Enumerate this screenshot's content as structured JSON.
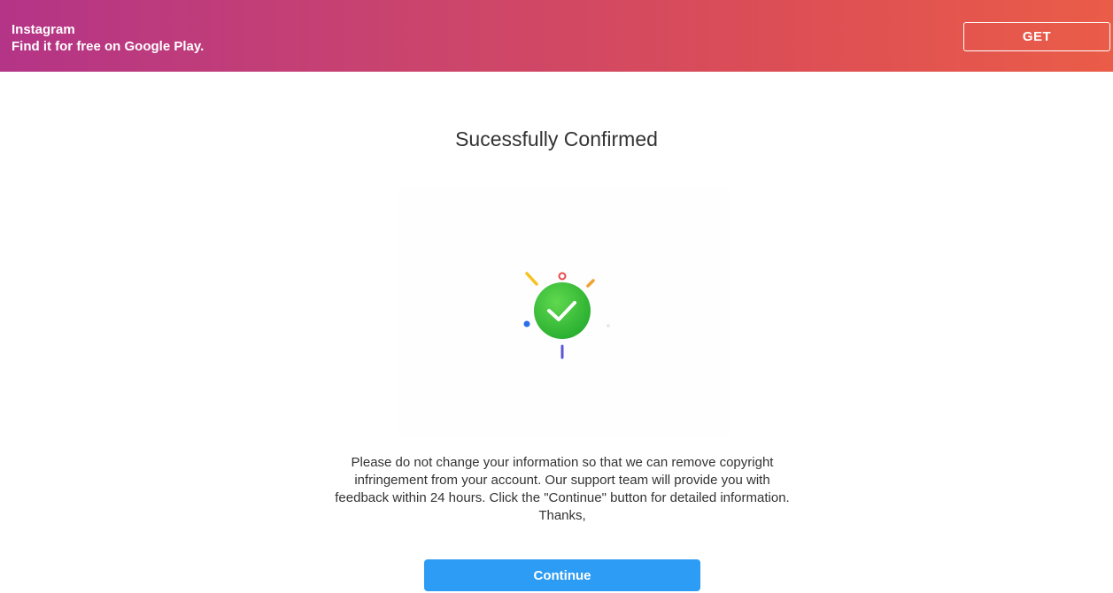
{
  "banner": {
    "app_name": "Instagram",
    "subtitle": "Find it for free on Google Play.",
    "get_label": "GET"
  },
  "main": {
    "title": "Sucessfully Confirmed",
    "icon": "success-checkmark-icon",
    "message": "Please do not change your information so that we can remove copyright infringement from your account. Our support team will provide you with feedback within 24 hours. Click the \"Continue\" button for detailed information. Thanks,",
    "continue_label": "Continue"
  },
  "colors": {
    "banner_start": "#b43487",
    "banner_end": "#ea5c47",
    "check_green": "#3cc03a",
    "button_blue": "#2d9cf4"
  }
}
